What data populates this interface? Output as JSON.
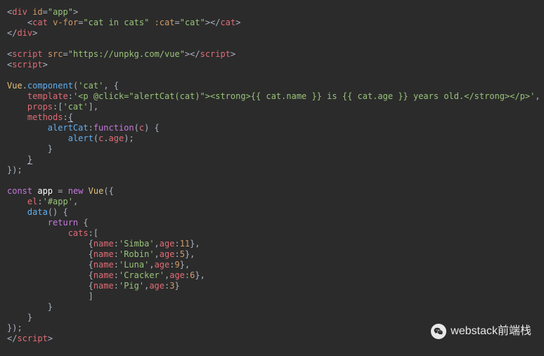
{
  "code_lines": [
    [
      {
        "c": "t-punc",
        "t": "<"
      },
      {
        "c": "t-tag",
        "t": "div"
      },
      {
        "c": "",
        "t": " "
      },
      {
        "c": "t-attr",
        "t": "id"
      },
      {
        "c": "t-punc",
        "t": "="
      },
      {
        "c": "t-str",
        "t": "\"app\""
      },
      {
        "c": "t-punc",
        "t": ">"
      }
    ],
    [
      {
        "c": "",
        "t": "    "
      },
      {
        "c": "t-punc",
        "t": "<"
      },
      {
        "c": "t-tag",
        "t": "cat"
      },
      {
        "c": "",
        "t": " "
      },
      {
        "c": "t-attr",
        "t": "v-for"
      },
      {
        "c": "t-punc",
        "t": "="
      },
      {
        "c": "t-str",
        "t": "\"cat in cats\""
      },
      {
        "c": "",
        "t": " "
      },
      {
        "c": "t-attr",
        "t": ":cat"
      },
      {
        "c": "t-punc",
        "t": "="
      },
      {
        "c": "t-str",
        "t": "\"cat\""
      },
      {
        "c": "t-punc",
        "t": "></"
      },
      {
        "c": "t-tag",
        "t": "cat"
      },
      {
        "c": "t-punc",
        "t": ">"
      }
    ],
    [
      {
        "c": "t-punc",
        "t": "</"
      },
      {
        "c": "t-tag",
        "t": "div"
      },
      {
        "c": "t-punc",
        "t": ">"
      }
    ],
    [
      {
        "c": "",
        "t": ""
      }
    ],
    [
      {
        "c": "t-punc",
        "t": "<"
      },
      {
        "c": "t-tag",
        "t": "script"
      },
      {
        "c": "",
        "t": " "
      },
      {
        "c": "t-attr",
        "t": "src"
      },
      {
        "c": "t-punc",
        "t": "="
      },
      {
        "c": "t-str",
        "t": "\"https://unpkg.com/vue\""
      },
      {
        "c": "t-punc",
        "t": "></"
      },
      {
        "c": "t-tag",
        "t": "script"
      },
      {
        "c": "t-punc",
        "t": ">"
      }
    ],
    [
      {
        "c": "t-punc",
        "t": "<"
      },
      {
        "c": "t-tag",
        "t": "script"
      },
      {
        "c": "t-punc",
        "t": ">"
      }
    ],
    [
      {
        "c": "",
        "t": ""
      }
    ],
    [
      {
        "c": "t-obj",
        "t": "Vue"
      },
      {
        "c": "t-punc",
        "t": "."
      },
      {
        "c": "t-fn",
        "t": "component"
      },
      {
        "c": "t-punc",
        "t": "("
      },
      {
        "c": "t-str",
        "t": "'cat'"
      },
      {
        "c": "t-punc",
        "t": ", {"
      }
    ],
    [
      {
        "c": "",
        "t": "    "
      },
      {
        "c": "t-prop",
        "t": "template"
      },
      {
        "c": "t-punc",
        "t": ":"
      },
      {
        "c": "t-str",
        "t": "'<p @click=\"alertCat(cat)\"><strong>{{ cat.name }} is {{ cat.age }} years old.</strong></p>'"
      },
      {
        "c": "t-punc",
        "t": ","
      }
    ],
    [
      {
        "c": "",
        "t": "    "
      },
      {
        "c": "t-prop",
        "t": "props"
      },
      {
        "c": "t-punc",
        "t": ":["
      },
      {
        "c": "t-str",
        "t": "'cat'"
      },
      {
        "c": "t-punc",
        "t": "],"
      }
    ],
    [
      {
        "c": "",
        "t": "    "
      },
      {
        "c": "t-prop",
        "t": "methods"
      },
      {
        "c": "t-punc",
        "t": ":"
      },
      {
        "c": "t-punc underline",
        "t": "{"
      }
    ],
    [
      {
        "c": "",
        "t": "        "
      },
      {
        "c": "t-fn",
        "t": "alertCat"
      },
      {
        "c": "t-punc",
        "t": ":"
      },
      {
        "c": "t-kw",
        "t": "function"
      },
      {
        "c": "t-punc",
        "t": "("
      },
      {
        "c": "t-param",
        "t": "c"
      },
      {
        "c": "t-punc",
        "t": ") {"
      }
    ],
    [
      {
        "c": "",
        "t": "            "
      },
      {
        "c": "t-fn",
        "t": "alert"
      },
      {
        "c": "t-punc",
        "t": "("
      },
      {
        "c": "t-prop",
        "t": "c"
      },
      {
        "c": "t-punc",
        "t": "."
      },
      {
        "c": "t-prop",
        "t": "age"
      },
      {
        "c": "t-punc",
        "t": ");"
      }
    ],
    [
      {
        "c": "",
        "t": "        "
      },
      {
        "c": "t-punc",
        "t": "}"
      }
    ],
    [
      {
        "c": "",
        "t": "    "
      },
      {
        "c": "t-punc underline",
        "t": "}"
      }
    ],
    [
      {
        "c": "t-punc",
        "t": "});"
      }
    ],
    [
      {
        "c": "",
        "t": ""
      }
    ],
    [
      {
        "c": "t-kw",
        "t": "const"
      },
      {
        "c": "",
        "t": " "
      },
      {
        "c": "t-white",
        "t": "app"
      },
      {
        "c": "",
        "t": " "
      },
      {
        "c": "t-punc",
        "t": "="
      },
      {
        "c": "",
        "t": " "
      },
      {
        "c": "t-kw",
        "t": "new"
      },
      {
        "c": "",
        "t": " "
      },
      {
        "c": "t-obj",
        "t": "Vue"
      },
      {
        "c": "t-punc",
        "t": "({"
      }
    ],
    [
      {
        "c": "",
        "t": "    "
      },
      {
        "c": "t-prop",
        "t": "el"
      },
      {
        "c": "t-punc",
        "t": ":"
      },
      {
        "c": "t-str",
        "t": "'#app'"
      },
      {
        "c": "t-punc",
        "t": ","
      }
    ],
    [
      {
        "c": "",
        "t": "    "
      },
      {
        "c": "t-fn",
        "t": "data"
      },
      {
        "c": "t-punc",
        "t": "() {"
      }
    ],
    [
      {
        "c": "",
        "t": "        "
      },
      {
        "c": "t-kw",
        "t": "return"
      },
      {
        "c": "",
        "t": " "
      },
      {
        "c": "t-punc",
        "t": "{"
      }
    ],
    [
      {
        "c": "",
        "t": "            "
      },
      {
        "c": "t-prop",
        "t": "cats"
      },
      {
        "c": "t-punc",
        "t": ":["
      }
    ],
    [
      {
        "c": "",
        "t": "                "
      },
      {
        "c": "t-punc",
        "t": "{"
      },
      {
        "c": "t-prop",
        "t": "name"
      },
      {
        "c": "t-punc",
        "t": ":"
      },
      {
        "c": "t-str",
        "t": "'Simba'"
      },
      {
        "c": "t-punc",
        "t": ","
      },
      {
        "c": "t-prop",
        "t": "age"
      },
      {
        "c": "t-punc",
        "t": ":"
      },
      {
        "c": "t-num",
        "t": "11"
      },
      {
        "c": "t-punc",
        "t": "},"
      }
    ],
    [
      {
        "c": "",
        "t": "                "
      },
      {
        "c": "t-punc",
        "t": "{"
      },
      {
        "c": "t-prop",
        "t": "name"
      },
      {
        "c": "t-punc",
        "t": ":"
      },
      {
        "c": "t-str",
        "t": "'Robin'"
      },
      {
        "c": "t-punc",
        "t": ","
      },
      {
        "c": "t-prop",
        "t": "age"
      },
      {
        "c": "t-punc",
        "t": ":"
      },
      {
        "c": "t-num",
        "t": "5"
      },
      {
        "c": "t-punc",
        "t": "},"
      }
    ],
    [
      {
        "c": "",
        "t": "                "
      },
      {
        "c": "t-punc",
        "t": "{"
      },
      {
        "c": "t-prop",
        "t": "name"
      },
      {
        "c": "t-punc",
        "t": ":"
      },
      {
        "c": "t-str",
        "t": "'Luna'"
      },
      {
        "c": "t-punc",
        "t": ","
      },
      {
        "c": "t-prop",
        "t": "age"
      },
      {
        "c": "t-punc",
        "t": ":"
      },
      {
        "c": "t-num",
        "t": "9"
      },
      {
        "c": "t-punc",
        "t": "},"
      }
    ],
    [
      {
        "c": "",
        "t": "                "
      },
      {
        "c": "t-punc",
        "t": "{"
      },
      {
        "c": "t-prop",
        "t": "name"
      },
      {
        "c": "t-punc",
        "t": ":"
      },
      {
        "c": "t-str",
        "t": "'Cracker'"
      },
      {
        "c": "t-punc",
        "t": ","
      },
      {
        "c": "t-prop",
        "t": "age"
      },
      {
        "c": "t-punc",
        "t": ":"
      },
      {
        "c": "t-num",
        "t": "6"
      },
      {
        "c": "t-punc",
        "t": "},"
      }
    ],
    [
      {
        "c": "",
        "t": "                "
      },
      {
        "c": "t-punc",
        "t": "{"
      },
      {
        "c": "t-prop",
        "t": "name"
      },
      {
        "c": "t-punc",
        "t": ":"
      },
      {
        "c": "t-str",
        "t": "'Pig'"
      },
      {
        "c": "t-punc",
        "t": ","
      },
      {
        "c": "t-prop",
        "t": "age"
      },
      {
        "c": "t-punc",
        "t": ":"
      },
      {
        "c": "t-num",
        "t": "3"
      },
      {
        "c": "t-punc",
        "t": "}"
      }
    ],
    [
      {
        "c": "",
        "t": "                "
      },
      {
        "c": "t-punc",
        "t": "]"
      }
    ],
    [
      {
        "c": "",
        "t": "        "
      },
      {
        "c": "t-punc",
        "t": "}"
      }
    ],
    [
      {
        "c": "",
        "t": "    "
      },
      {
        "c": "t-punc",
        "t": "}"
      }
    ],
    [
      {
        "c": "t-punc",
        "t": "});"
      }
    ],
    [
      {
        "c": "t-punc",
        "t": "</"
      },
      {
        "c": "t-tag",
        "t": "script"
      },
      {
        "c": "t-punc",
        "t": ">"
      }
    ]
  ],
  "watermark": "webstack前端栈"
}
